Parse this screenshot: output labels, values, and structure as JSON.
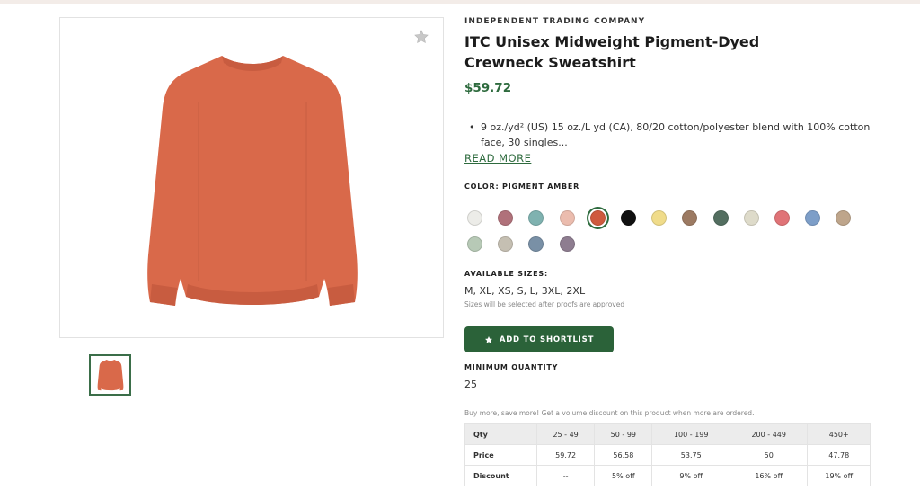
{
  "product": {
    "brand": "INDEPENDENT TRADING COMPANY",
    "title": "ITC Unisex Midweight Pigment-Dyed Crewneck Sweatshirt",
    "price": "$59.72",
    "description": "9 oz./yd² (US) 15 oz./L yd (CA), 80/20 cotton/polyester blend with 100% cotton face, 30 singles...",
    "read_more": "READ MORE",
    "image_color": "#d9694a"
  },
  "colors": {
    "label": "COLOR: PIGMENT AMBER",
    "selected_index": 4,
    "swatches": [
      "#ecece8",
      "#b0717a",
      "#7fb2b0",
      "#ebbcae",
      "#cf5a3e",
      "#101010",
      "#f0dc8a",
      "#9c7a62",
      "#536e60",
      "#dedbca",
      "#e07377",
      "#7d9ec8",
      "#bea58b",
      "#b7c9b6",
      "#c5bfb2",
      "#7990a6",
      "#8e7d90"
    ]
  },
  "sizes": {
    "label": "AVAILABLE SIZES:",
    "value": "M, XL, XS, S, L, 3XL, 2XL",
    "note": "Sizes will be selected after proofs are approved"
  },
  "shortlist": {
    "label": "ADD TO SHORTLIST"
  },
  "minimum": {
    "label": "MINIMUM QUANTITY",
    "value": "25"
  },
  "pricing": {
    "note": "Buy more, save more! Get a volume discount on this product when more are ordered.",
    "headers": [
      "Qty",
      "25 - 49",
      "50 - 99",
      "100 - 199",
      "200 - 449",
      "450+"
    ],
    "price_row": [
      "Price",
      "59.72",
      "56.58",
      "53.75",
      "50",
      "47.78"
    ],
    "discount_row": [
      "Discount",
      "--",
      "5% off",
      "9% off",
      "16% off",
      "19% off"
    ]
  },
  "colors_theme": {
    "accent": "#2e6b3e",
    "button": "#2b6239"
  }
}
